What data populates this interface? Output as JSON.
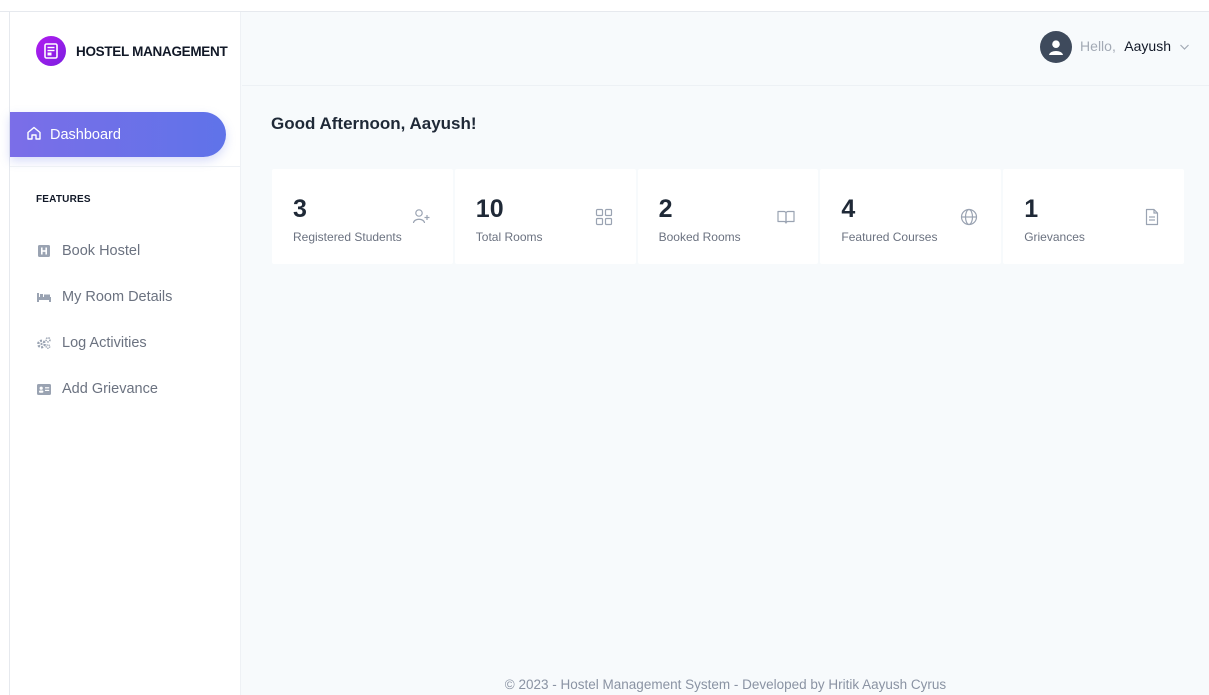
{
  "brand": {
    "name": "HOSTEL MANAGEMENT"
  },
  "sidebar": {
    "active": {
      "label": "Dashboard",
      "icon": "home-icon"
    },
    "section_title": "FEATURES",
    "items": [
      {
        "label": "Book Hostel",
        "icon": "hostel-icon"
      },
      {
        "label": "My Room Details",
        "icon": "bed-icon"
      },
      {
        "label": "Log Activities",
        "icon": "cogs-icon"
      },
      {
        "label": "Add Grievance",
        "icon": "id-card-icon"
      }
    ]
  },
  "header": {
    "hello": "Hello,",
    "user_name": "Aayush"
  },
  "main": {
    "greeting": "Good Afternoon, Aayush!",
    "cards": [
      {
        "value": "3",
        "label": "Registered Students",
        "icon": "user-plus-icon"
      },
      {
        "value": "10",
        "label": "Total Rooms",
        "icon": "grid-icon"
      },
      {
        "value": "2",
        "label": "Booked Rooms",
        "icon": "book-open-icon"
      },
      {
        "value": "4",
        "label": "Featured Courses",
        "icon": "globe-icon"
      },
      {
        "value": "1",
        "label": "Grievances",
        "icon": "document-icon"
      }
    ]
  },
  "footer": {
    "text": "© 2023 - Hostel Management System - Developed by Hritik Aayush Cyrus"
  },
  "colors": {
    "accent": "#6a70e8",
    "brand_logo": "#9b1ee8"
  }
}
